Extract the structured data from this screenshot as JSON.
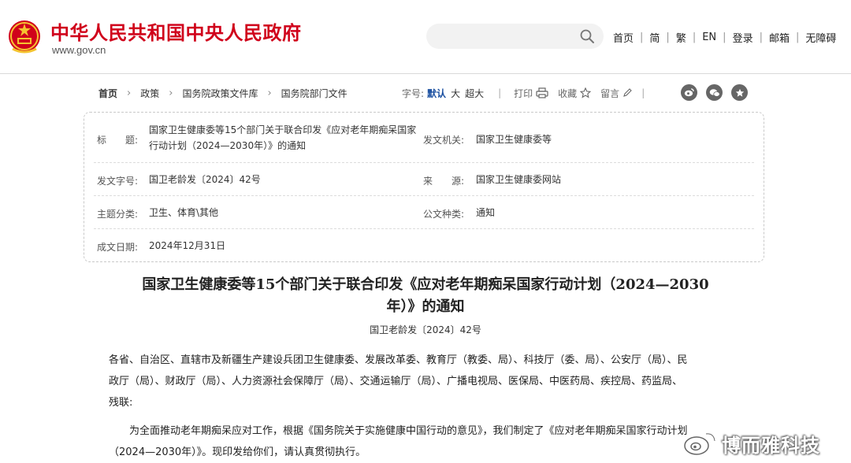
{
  "header": {
    "site_title": "中华人民共和国中央人民政府",
    "site_url": "www.gov.cn",
    "search": {
      "value": "",
      "placeholder": ""
    },
    "nav": [
      "首页",
      "简",
      "繁",
      "EN",
      "登录",
      "邮箱",
      "无障碍"
    ]
  },
  "breadcrumb": [
    "首页",
    "政策",
    "国务院政策文件库",
    "国务院部门文件"
  ],
  "tools": {
    "font_size_label": "字号:",
    "font_sizes": [
      "默认",
      "大",
      "超大"
    ],
    "active_font_size": "默认",
    "print": "打印",
    "favorite": "收藏",
    "comment": "留言"
  },
  "share_icons": [
    "weibo-icon",
    "wechat-icon",
    "star-icon"
  ],
  "meta": {
    "title_label": "标　　题:",
    "title_line1": "国家卫生健康委等15个部门关于联合印发《应对老年期痴呆国家",
    "title_line2": "行动计划（2024—2030年）》的通知",
    "issuer_label": "发文机关:",
    "issuer": "国家卫生健康委等",
    "doc_no_label": "发文字号:",
    "doc_no": "国卫老龄发〔2024〕42号",
    "source_label": "来　　源:",
    "source": "国家卫生健康委网站",
    "topic_label": "主题分类:",
    "topic": "卫生、体育\\其他",
    "doc_type_label": "公文种类:",
    "doc_type": "通知",
    "date_label": "成文日期:",
    "date": "2024年12月31日"
  },
  "article": {
    "title_line1": "国家卫生健康委等15个部门关于联合印发《应对老年期痴呆国家行动计划（2024—2030",
    "title_line2": "年）》的通知",
    "doc_no": "国卫老龄发〔2024〕42号",
    "para1_line1": "各省、自治区、直辖市及新疆生产建设兵团卫生健康委、发展改革委、教育厅（教委、局）、科技厅（委、局）、公安厅（局）、民",
    "para1_line2": "政厅（局）、财政厅（局）、人力资源社会保障厅（局）、交通运输厅（局）、广播电视局、医保局、中医药局、疾控局、药监局、",
    "para1_line3": "残联:",
    "para2_line1": "为全面推动老年期痴呆应对工作，根据《国务院关于实施健康中国行动的意见》，我们制定了《应对老年期痴呆国家行动计划",
    "para2_line2": "（2024—2030年）》。现印发给你们，请认真贯彻执行。"
  },
  "watermark": "博而雅科技",
  "colors": {
    "brand_red": "#d0021b",
    "active_blue": "#1a4fa0"
  }
}
